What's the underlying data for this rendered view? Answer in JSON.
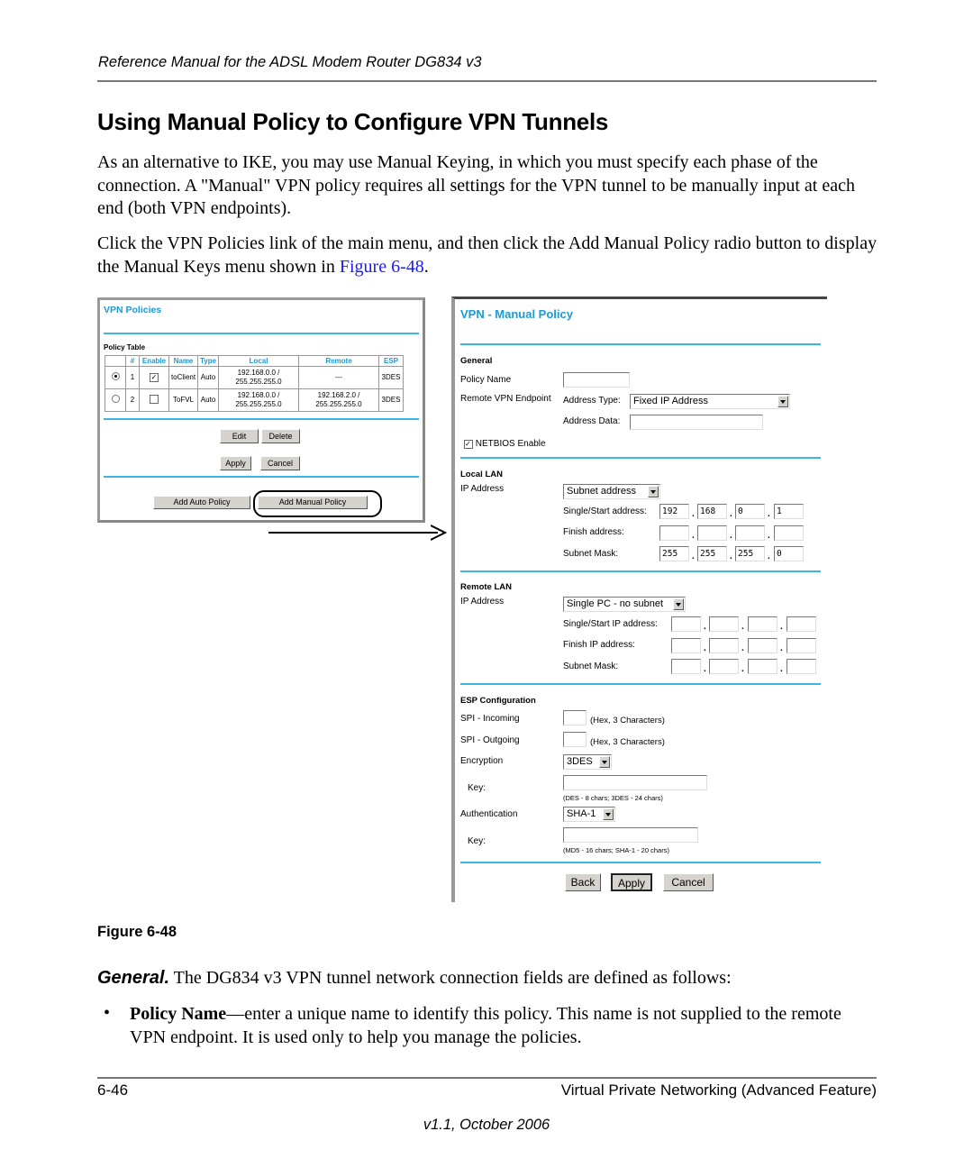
{
  "header": {
    "running_title": "Reference Manual for the ADSL Modem Router DG834 v3"
  },
  "section_title": "Using Manual Policy to Configure VPN Tunnels",
  "paragraphs": {
    "p1": "As an alternative to IKE, you may use Manual Keying, in which you must specify each phase of the connection. A \"Manual\" VPN policy requires all settings for the VPN tunnel to be manually input at each end (both VPN endpoints).",
    "p2_before": "Click the VPN Policies link of the main menu, and then click the Add Manual Policy radio button to display the Manual Keys menu shown in ",
    "p2_link": "Figure 6-48",
    "p2_after": "."
  },
  "vpn_policies": {
    "title": "VPN Policies",
    "table_caption": "Policy Table",
    "columns": [
      "",
      "#",
      "Enable",
      "Name",
      "Type",
      "Local",
      "Remote",
      "ESP"
    ],
    "rows": [
      {
        "selected": true,
        "num": "1",
        "enabled": true,
        "name": "toClient",
        "type": "Auto",
        "local_ip": "192.168.0.0 /",
        "local_mask": "255.255.255.0",
        "remote_ip": "---",
        "remote_mask": "",
        "esp": "3DES"
      },
      {
        "selected": false,
        "num": "2",
        "enabled": false,
        "name": "ToFVL",
        "type": "Auto",
        "local_ip": "192.168.0.0 /",
        "local_mask": "255.255.255.0",
        "remote_ip": "192.168.2.0 /",
        "remote_mask": "255.255.255.0",
        "esp": "3DES"
      }
    ],
    "buttons": {
      "edit": "Edit",
      "delete": "Delete",
      "apply": "Apply",
      "cancel": "Cancel",
      "add_auto": "Add Auto Policy",
      "add_manual": "Add Manual Policy"
    }
  },
  "manual_policy": {
    "title": "VPN - Manual Policy",
    "general": {
      "heading": "General",
      "policy_name_label": "Policy Name",
      "policy_name_value": "",
      "remote_endpoint_label": "Remote VPN Endpoint",
      "address_type_label": "Address Type:",
      "address_type_value": "Fixed IP Address",
      "address_data_label": "Address Data:",
      "address_data_value": "",
      "netbios_label": "NETBIOS Enable",
      "netbios_checked": true
    },
    "local_lan": {
      "heading": "Local LAN",
      "ip_label": "IP Address",
      "ip_type": "Subnet address",
      "start_label": "Single/Start address:",
      "start": [
        "192",
        "168",
        "0",
        "1"
      ],
      "finish_label": "Finish address:",
      "finish": [
        "",
        "",
        "",
        ""
      ],
      "mask_label": "Subnet Mask:",
      "mask": [
        "255",
        "255",
        "255",
        "0"
      ]
    },
    "remote_lan": {
      "heading": "Remote LAN",
      "ip_label": "IP Address",
      "ip_type": "Single PC - no subnet",
      "start_label": "Single/Start IP address:",
      "start": [
        "",
        "",
        "",
        ""
      ],
      "finish_label": "Finish IP address:",
      "finish": [
        "",
        "",
        "",
        ""
      ],
      "mask_label": "Subnet Mask:",
      "mask": [
        "",
        "",
        "",
        ""
      ]
    },
    "esp": {
      "heading": "ESP Configuration",
      "spi_in_label": "SPI - Incoming",
      "spi_out_label": "SPI - Outgoing",
      "spi_hint": "(Hex, 3 Characters)",
      "encryption_label": "Encryption",
      "encryption_value": "3DES",
      "enc_key_label": "Key:",
      "enc_key_hint": "(DES - 8 chars;   3DES - 24 chars)",
      "auth_label": "Authentication",
      "auth_value": "SHA-1",
      "auth_key_label": "Key:",
      "auth_key_hint": "(MD5 - 16 chars;   SHA-1 - 20 chars)"
    },
    "buttons": {
      "back": "Back",
      "apply": "Apply",
      "cancel": "Cancel"
    }
  },
  "figure_caption": "Figure 6-48",
  "general_para": {
    "lead": "General.",
    "text": " The DG834 v3 VPN tunnel network connection fields are defined as follows:"
  },
  "bullets": [
    {
      "symbol": "•",
      "term": "Policy Name",
      "text": "—enter a unique name to identify this policy. This name is not supplied to the remote VPN endpoint. It is used only to help you manage the policies."
    }
  ],
  "footer": {
    "page_number": "6-46",
    "chapter": "Virtual Private Networking (Advanced Feature)",
    "version": "v1.1, October 2006"
  }
}
